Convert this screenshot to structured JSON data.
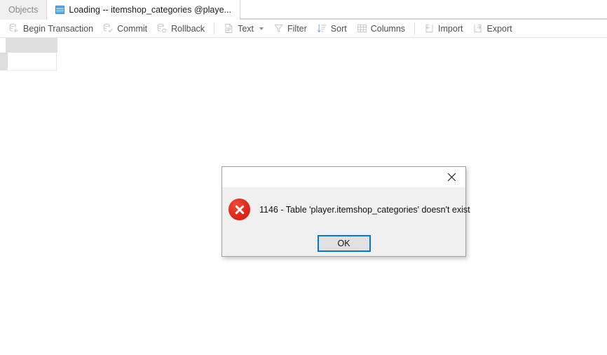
{
  "window": {
    "background_color": "#ffffff"
  },
  "tabbar": {
    "tabs": [
      {
        "label": "Objects",
        "icon": "none",
        "active": false
      },
      {
        "label": "Loading -- itemshop_categories @playe...",
        "icon": "table-grid-icon",
        "active": true
      }
    ]
  },
  "toolbar": {
    "items": [
      {
        "label": "Begin Transaction",
        "icon": "transaction-begin-icon"
      },
      {
        "label": "Commit",
        "icon": "transaction-commit-icon"
      },
      {
        "label": "Rollback",
        "icon": "transaction-rollback-icon"
      },
      {
        "separator_after_previous": true,
        "label": "Text",
        "icon": "document-text-icon",
        "has_dropdown": true
      },
      {
        "label": "Filter",
        "icon": "funnel-icon"
      },
      {
        "label": "Sort",
        "icon": "sort-icon"
      },
      {
        "label": "Columns",
        "icon": "columns-grid-icon"
      },
      {
        "separator_after_previous": true,
        "label": "Import",
        "icon": "import-arrow-icon"
      },
      {
        "label": "Export",
        "icon": "export-arrow-icon"
      }
    ]
  },
  "dialog": {
    "title": "",
    "close_label": "✕",
    "icon": "error-circle-x-icon",
    "message": "1146 - Table 'player.itemshop_categories' doesn't exist",
    "buttons": [
      {
        "label": "OK",
        "focused": true
      }
    ],
    "accent_color": "#0078d7",
    "error_color": "#e02718",
    "background_color": "#f0f0f0"
  }
}
